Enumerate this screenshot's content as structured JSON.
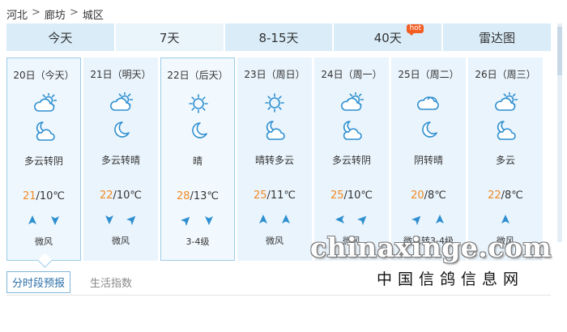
{
  "breadcrumb": {
    "province": "河北",
    "city": "廊坊",
    "district": "城区",
    "separator": ">"
  },
  "tabs": [
    {
      "label": "今天"
    },
    {
      "label": "7天"
    },
    {
      "label": "8-15天"
    },
    {
      "label": "40天",
      "badge": "hot"
    },
    {
      "label": "雷达图"
    }
  ],
  "days": [
    {
      "date": "20日（今天）",
      "day_icon": "partly-cloudy-sun-icon",
      "night_icon": "partly-cloudy-moon-icon",
      "desc": "多云转阴",
      "high": "21",
      "low": "/10℃",
      "wind": "微风",
      "wind_dirs": [
        "up",
        "down"
      ]
    },
    {
      "date": "21日（明天）",
      "day_icon": "partly-cloudy-sun-icon",
      "night_icon": "moon-icon",
      "desc": "多云转晴",
      "high": "22",
      "low": "/10℃",
      "wind": "微风",
      "wind_dirs": [
        "down",
        "up-right"
      ]
    },
    {
      "date": "22日（后天）",
      "day_icon": "sun-icon",
      "night_icon": "moon-icon",
      "desc": "晴",
      "high": "28",
      "low": "/13℃",
      "wind": "3-4级",
      "wind_dirs": [
        "up-right",
        "down"
      ]
    },
    {
      "date": "23日（周日）",
      "day_icon": "sun-icon",
      "night_icon": "partly-cloudy-moon-icon",
      "desc": "晴转多云",
      "high": "25",
      "low": "/11℃",
      "wind": "微风",
      "wind_dirs": [
        "up",
        "up"
      ]
    },
    {
      "date": "24日（周一）",
      "day_icon": "partly-cloudy-sun-icon",
      "night_icon": "partly-cloudy-moon-icon",
      "desc": "多云转阴",
      "high": "25",
      "low": "/10℃",
      "wind": "微风",
      "wind_dirs": [
        "left",
        "up-right"
      ]
    },
    {
      "date": "25日（周二）",
      "day_icon": "cloud-icon",
      "night_icon": "moon-icon",
      "desc": "阴转晴",
      "high": "20",
      "low": "/8℃",
      "wind": "微风转3-4级",
      "wind_dirs": [
        "up-right",
        "up"
      ]
    },
    {
      "date": "26日（周三）",
      "day_icon": "partly-cloudy-sun-icon",
      "night_icon": "partly-cloudy-moon-icon",
      "desc": "多云",
      "high": "22",
      "low": "/8℃",
      "wind": "微风",
      "wind_dirs": [
        "up"
      ]
    }
  ],
  "bottom_tabs": [
    {
      "label": "分时段预报"
    },
    {
      "label": "生活指数"
    }
  ],
  "watermark": {
    "text": "chinaxinge.com",
    "subtitle": "中国信鸽信息网"
  },
  "colors": {
    "tab_bg": "#d9ecf8",
    "card_bg": "#eaf4fc",
    "icon_blue": "#2e8fd0",
    "high_temp": "#f08a24"
  }
}
